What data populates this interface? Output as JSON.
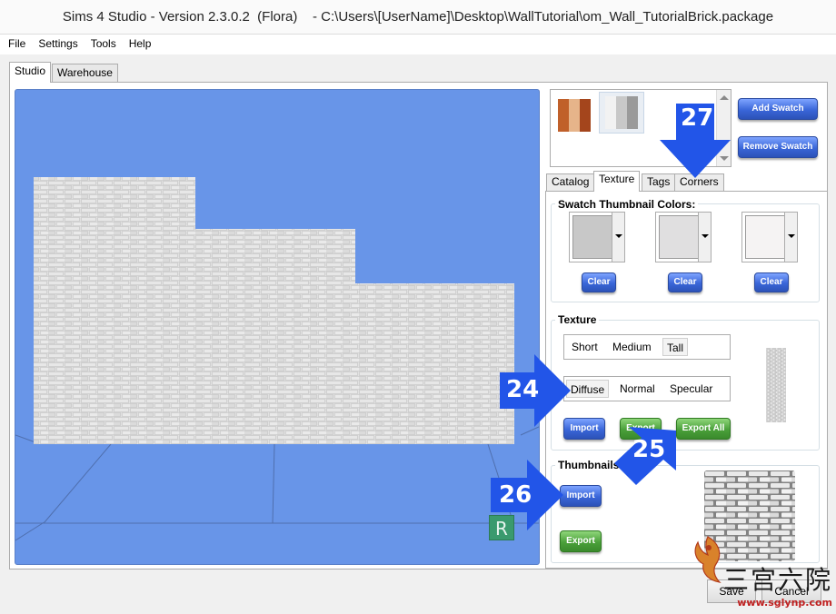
{
  "window": {
    "title": "Sims 4 Studio - Version 2.3.0.2  (Flora)    - C:\\Users\\[UserName]\\Desktop\\WallTutorial\\om_Wall_TutorialBrick.package"
  },
  "menu": {
    "items": [
      "File",
      "Settings",
      "Tools",
      "Help"
    ]
  },
  "main_tabs": {
    "studio": "Studio",
    "warehouse": "Warehouse"
  },
  "viewport": {
    "badge": "R",
    "background_color": "#6895e8"
  },
  "swatches": {
    "add_label": "Add Swatch",
    "remove_label": "Remove Swatch",
    "swatch1_colors": [
      "#c0602a",
      "#e6b48a",
      "#a4451c"
    ],
    "swatch2_colors": [
      "#f2f2f2",
      "#c8c8c8",
      "#9a9a9a"
    ]
  },
  "sub_tabs": {
    "catalog": "Catalog",
    "texture": "Texture",
    "tags": "Tags",
    "corners": "Corners"
  },
  "swatch_colors": {
    "title": "Swatch Thumbnail Colors:",
    "clear_label": "Clear",
    "colors": [
      "#c8c8c8",
      "#e0dfe0",
      "#f5f3f3"
    ]
  },
  "texture": {
    "title": "Texture",
    "sizes": {
      "short": "Short",
      "medium": "Medium",
      "tall": "Tall"
    },
    "maps": {
      "diffuse": "Diffuse",
      "normal": "Normal",
      "specular": "Specular"
    },
    "import_label": "Import",
    "export_label": "Export",
    "export_all_label": "Export All"
  },
  "thumbnails": {
    "title": "Thumbnails",
    "import_label": "Import",
    "export_label": "Export"
  },
  "annotations": {
    "a24": "24",
    "a25": "25",
    "a26": "26",
    "a27": "27"
  },
  "footer": {
    "save_label": "Save",
    "cancel_label": "Cancel"
  },
  "watermark": {
    "text": "三宫六院",
    "url": "www.sglynp.com"
  }
}
